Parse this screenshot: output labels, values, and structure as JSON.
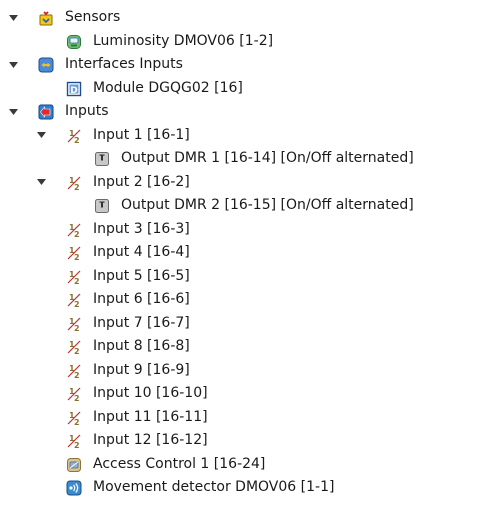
{
  "tree": [
    {
      "label": "Sensors",
      "icon": "sensors-icon",
      "expanded": true,
      "level": 0
    },
    {
      "label": "Luminosity DMOV06 [1-2]",
      "icon": "luminosity-icon",
      "level": 1
    },
    {
      "label": "Interfaces Inputs",
      "icon": "interfaces-icon",
      "expanded": true,
      "level": 0
    },
    {
      "label": "Module DGQG02 [16]",
      "icon": "module-icon",
      "level": 1
    },
    {
      "label": "Inputs",
      "icon": "inputs-icon",
      "expanded": true,
      "level": 0
    },
    {
      "label": "Input 1 [16-1]",
      "icon": "input-icon",
      "expanded": true,
      "level": 1
    },
    {
      "label": "Output DMR 1 [16-14] [On/Off alternated]",
      "icon": "output-icon",
      "level": 2
    },
    {
      "label": "Input 2 [16-2]",
      "icon": "input-icon",
      "expanded": true,
      "level": 1
    },
    {
      "label": "Output DMR 2 [16-15] [On/Off alternated]",
      "icon": "output-icon",
      "level": 2
    },
    {
      "label": "Input 3 [16-3]",
      "icon": "input-icon",
      "level": 1
    },
    {
      "label": "Input 4 [16-4]",
      "icon": "input-icon",
      "level": 1
    },
    {
      "label": "Input 5 [16-5]",
      "icon": "input-icon",
      "level": 1
    },
    {
      "label": "Input 6 [16-6]",
      "icon": "input-icon",
      "level": 1
    },
    {
      "label": "Input 7 [16-7]",
      "icon": "input-icon",
      "level": 1
    },
    {
      "label": "Input 8 [16-8]",
      "icon": "input-icon",
      "level": 1
    },
    {
      "label": "Input 9 [16-9]",
      "icon": "input-icon",
      "level": 1
    },
    {
      "label": "Input 10 [16-10]",
      "icon": "input-icon",
      "level": 1
    },
    {
      "label": "Input 11 [16-11]",
      "icon": "input-icon",
      "level": 1
    },
    {
      "label": "Input 12 [16-12]",
      "icon": "input-icon",
      "level": 1
    },
    {
      "label": "Access Control 1 [16-24]",
      "icon": "access-control-icon",
      "level": 1
    },
    {
      "label": "Movement detector DMOV06 [1-1]",
      "icon": "movement-detector-icon",
      "level": 1
    }
  ],
  "colors": {
    "text": "#1a1a1a",
    "sensors_icon": "#e8b400",
    "interfaces_icon": "#3a7fd0",
    "inputs_icon": "#d93030",
    "input_icon": "#a89050",
    "output_icon": "#9a9a9a",
    "luminosity_icon": "#44aa55",
    "access_control_icon": "#c8b070",
    "movement_icon": "#3a8ad0"
  }
}
